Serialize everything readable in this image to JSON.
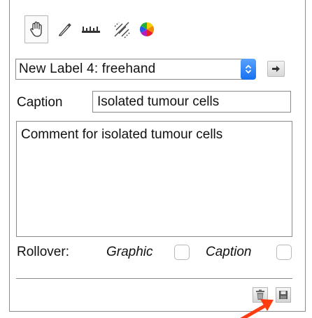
{
  "toolbar": {
    "tools": [
      {
        "name": "hand-icon",
        "active": true
      },
      {
        "name": "pen-icon",
        "active": false
      },
      {
        "name": "ruler-icon",
        "active": false
      },
      {
        "name": "hatch-brush-icon",
        "active": false
      },
      {
        "name": "color-wheel-icon",
        "active": false
      }
    ]
  },
  "label_select": {
    "value": "New Label 4: freehand"
  },
  "caption": {
    "label": "Caption",
    "value": "Isolated tumour cells"
  },
  "comment": {
    "value": "Comment for isolated tumour cells"
  },
  "rollover": {
    "label": "Rollover:",
    "graphic_label": "Graphic",
    "caption_label": "Caption",
    "graphic_checked": false,
    "caption_checked": false
  },
  "colors": {
    "stepper_blue": "#1670f0",
    "annotation_arrow": "#ff3b10"
  },
  "icons": {
    "delete": "trash-icon",
    "save": "floppy-disk-icon",
    "go": "arrow-right-icon"
  }
}
